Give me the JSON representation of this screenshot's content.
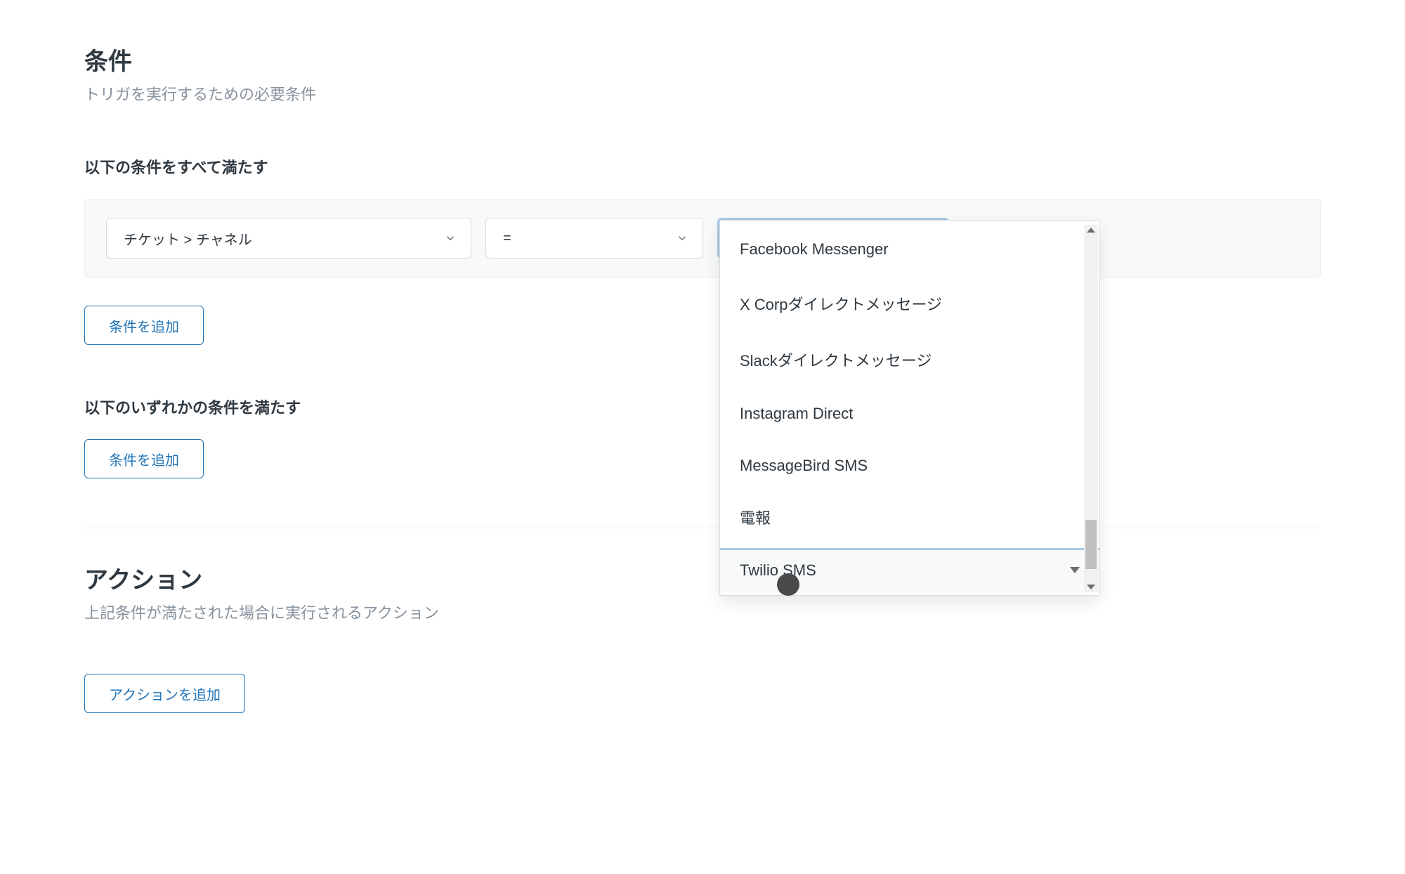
{
  "conditions": {
    "title": "条件",
    "subtitle": "トリガを実行するための必要条件",
    "all_label": "以下の条件をすべて満たす",
    "any_label": "以下のいずれかの条件を満たす",
    "add_button": "条件を追加",
    "row": {
      "field_value": "チケット > チャネル",
      "operator_value": "="
    }
  },
  "actions": {
    "title": "アクション",
    "subtitle": "上記条件が満たされた場合に実行されるアクション",
    "add_button": "アクションを追加"
  },
  "channel_dropdown": {
    "options": [
      "Facebook Messenger",
      "X Corpダイレクトメッセージ",
      "Slackダイレクトメッセージ",
      "Instagram Direct",
      "MessageBird SMS",
      "電報"
    ],
    "selected": "Twilio SMS"
  }
}
